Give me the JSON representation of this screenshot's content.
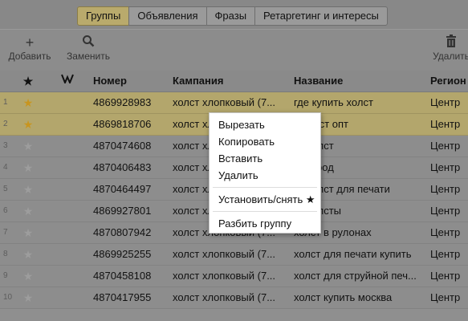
{
  "tabs": [
    {
      "label": "Группы",
      "active": true
    },
    {
      "label": "Объявления",
      "active": false
    },
    {
      "label": "Фразы",
      "active": false
    },
    {
      "label": "Ретаргетинг и интересы",
      "active": false
    }
  ],
  "toolbar": {
    "add_label": "Добавить",
    "replace_label": "Заменить",
    "delete_label": "Удалить"
  },
  "table": {
    "headers": {
      "star": "★",
      "mark": "",
      "id": "Номер",
      "campaign": "Кампания",
      "name": "Название",
      "region": "Регион"
    },
    "rows": [
      {
        "n": "1",
        "starred": true,
        "id": "4869928983",
        "campaign": "холст хлопковый (7...",
        "name": "где купить холст",
        "region": "Центр"
      },
      {
        "n": "2",
        "starred": true,
        "id": "4869818706",
        "campaign": "холст хлопковый (7...",
        "name": "а холст опт",
        "region": "Центр"
      },
      {
        "n": "3",
        "starred": false,
        "id": "4870474608",
        "campaign": "холст хлопковый (7...",
        "name": "ть холст",
        "region": "Центр"
      },
      {
        "n": "4",
        "starred": false,
        "id": "4870406483",
        "campaign": "холст хлопковый (7...",
        "name": "ть город",
        "region": "Центр"
      },
      {
        "n": "5",
        "starred": false,
        "id": "4870464497",
        "campaign": "холст хлопковый (7...",
        "name": "ть холст для печати",
        "region": "Центр"
      },
      {
        "n": "6",
        "starred": false,
        "id": "4869927801",
        "campaign": "холст хлопковый (7...",
        "name": "ть холсты",
        "region": "Центр"
      },
      {
        "n": "7",
        "starred": false,
        "id": "4870807942",
        "campaign": "холст хлопковый (7...",
        "name": "холст в рулонах",
        "region": "Центр"
      },
      {
        "n": "8",
        "starred": false,
        "id": "4869925255",
        "campaign": "холст хлопковый (7...",
        "name": "холст для печати купить",
        "region": "Центр"
      },
      {
        "n": "9",
        "starred": false,
        "id": "4870458108",
        "campaign": "холст хлопковый (7...",
        "name": "холст для струйной печ...",
        "region": "Центр"
      },
      {
        "n": "10",
        "starred": false,
        "id": "4870417955",
        "campaign": "холст хлопковый (7...",
        "name": "холст купить москва",
        "region": "Центр"
      }
    ]
  },
  "context_menu": {
    "cut": "Вырезать",
    "copy": "Копировать",
    "paste": "Вставить",
    "delete": "Удалить",
    "toggle_star": "Установить/снять ★",
    "split_group": "Разбить группу"
  },
  "icons": {
    "add": "plus-icon",
    "replace": "search-icon",
    "delete": "trash-icon",
    "star": "star-icon"
  },
  "colors": {
    "selected_row": "#b3a66c",
    "star_active": "#c8951f",
    "active_tab": "#b9aa6c"
  }
}
